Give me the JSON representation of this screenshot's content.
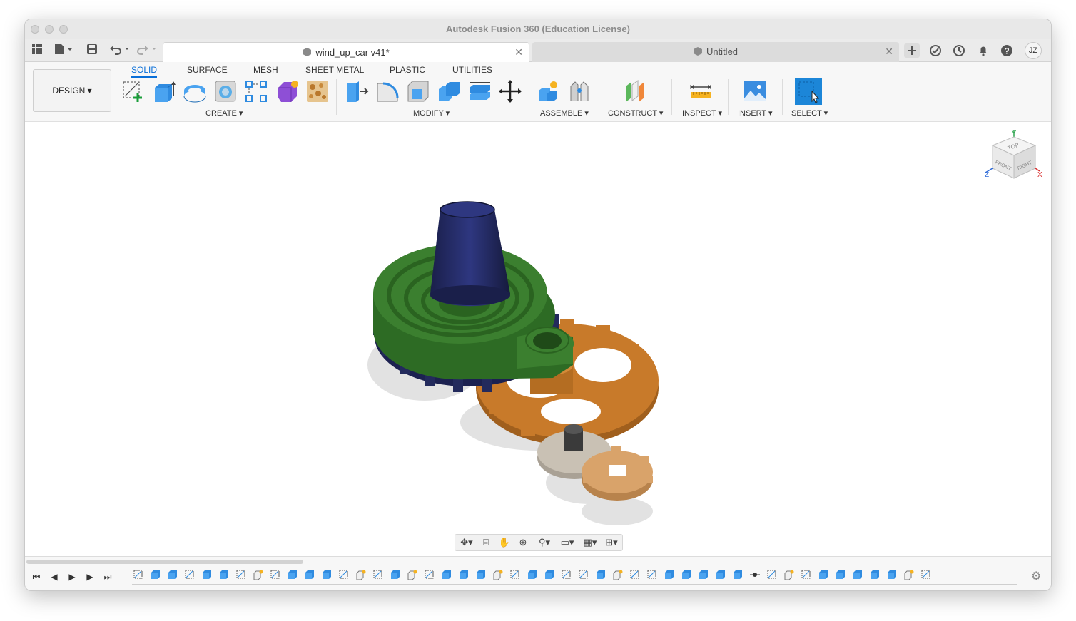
{
  "window": {
    "title": "Autodesk Fusion 360 (Education License)"
  },
  "tabs": [
    {
      "label": "wind_up_car v41*",
      "active": true
    },
    {
      "label": "Untitled",
      "active": false
    }
  ],
  "user": {
    "initials": "JZ"
  },
  "workspace": {
    "label": "DESIGN"
  },
  "ribbon_tabs": [
    "SOLID",
    "SURFACE",
    "MESH",
    "SHEET METAL",
    "PLASTIC",
    "UTILITIES"
  ],
  "groups": {
    "create": "CREATE",
    "modify": "MODIFY",
    "assemble": "ASSEMBLE",
    "construct": "CONSTRUCT",
    "inspect": "INSPECT",
    "insert": "INSERT",
    "select": "SELECT"
  },
  "viewcube": {
    "top": "TOP",
    "front": "FRONT",
    "right": "RIGHT",
    "x": "X",
    "y": "Y",
    "z": "Z"
  },
  "colors": {
    "accent": "#0a6fd8",
    "green_part": "#3b7f2f",
    "navy_knob": "#232a5c",
    "orange_gear": "#c87a2a",
    "tan_gear": "#d9a36a",
    "grey_gear": "#c9c1b4"
  }
}
